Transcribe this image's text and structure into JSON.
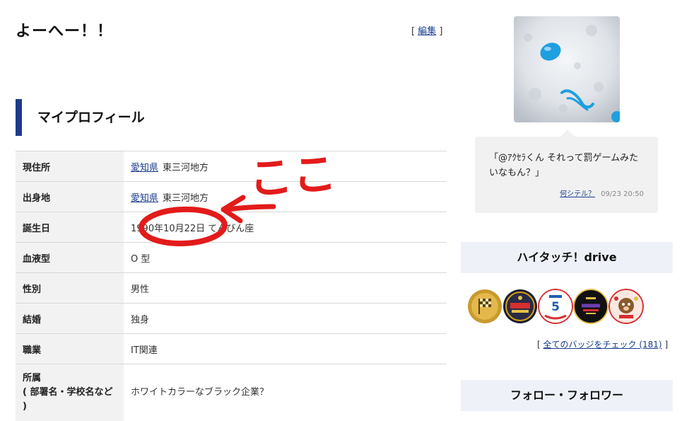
{
  "page": {
    "title": "よーへー！！",
    "edit_open": "[",
    "edit_label": "編集",
    "edit_close": "]"
  },
  "profile": {
    "heading": "マイプロフィール",
    "rows": [
      {
        "label": "現住所",
        "link": "愛知県",
        "text": "東三河地方"
      },
      {
        "label": "出身地",
        "link": "愛知県",
        "text": "東三河地方"
      },
      {
        "label": "誕生日",
        "text": "1990年10月22日 てんびん座"
      },
      {
        "label": "血液型",
        "text": "O 型"
      },
      {
        "label": "性別",
        "text": "男性"
      },
      {
        "label": "結婚",
        "text": "独身"
      },
      {
        "label": "職業",
        "text": "IT関連"
      },
      {
        "label": "所属\n( 部署名・学校名など )",
        "text": "ホワイトカラーなブラック企業？"
      }
    ]
  },
  "comment": {
    "text": "「@ｱｸｾﾗくん それって罰ゲームみたいなもん？」",
    "author": "何シテル？",
    "timestamp": "09/23 20:50"
  },
  "hitouch": {
    "heading": "ハイタッチ！drive",
    "badges": [
      "checkered-flag-badge",
      "motor-fes-badge",
      "5th-anniversary-badge",
      "tokyo-auto-salon-badge",
      "happy-new-year-2019-badge"
    ],
    "check_open": "[",
    "check_link": "全てのバッジをチェック (181)",
    "check_close": "]"
  },
  "follow": {
    "heading": "フォロー・フォロワー"
  },
  "annotation": {
    "text": "ここ",
    "color": "#e31b1b"
  }
}
